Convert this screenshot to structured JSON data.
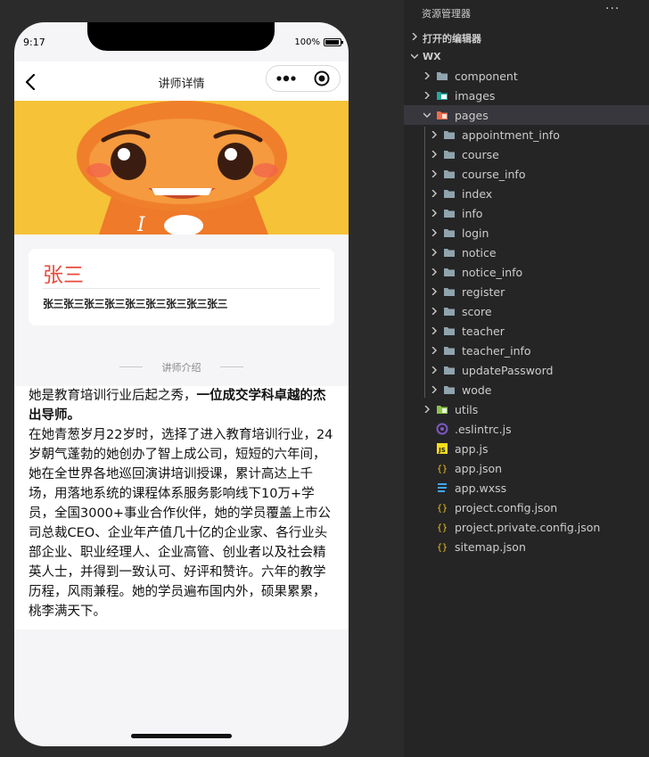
{
  "phone": {
    "status": {
      "time": "9:17",
      "battery": "100%"
    },
    "navbar": {
      "title": "讲师详情"
    },
    "teacher": {
      "name": "张三",
      "subtitle": "张三张三张三张三张三张三张三张三张三"
    },
    "section_title": "讲师介绍",
    "intro": {
      "text_before": "她是教育培训行业后起之秀，",
      "highlight": "一位成交学科卓越的杰出导师。",
      "text_after": "在她青葱岁月22岁时，选择了进入教育培训行业，24岁朝气蓬勃的她创办了智上成公司，短短的六年间，她在全世界各地巡回演讲培训授课，累计高达上千场，用落地系统的课程体系服务影响线下10万+学员，全国3000+事业合作伙伴，她的学员覆盖上市公司总裁CEO、企业年产值几十亿的企业家、各行业头部企业、职业经理人、企业高管、创业者以及社会精英人士，并得到一致认可、好评和赞许。六年的教学历程，风雨兼程。她的学员遍布国内外，硕果累累，桃李满天下。"
    }
  },
  "explorer": {
    "title": "资源管理器",
    "more": "···",
    "open_editors": "打开的编辑器",
    "root": "WX",
    "items": [
      {
        "label": "component",
        "type": "folder"
      },
      {
        "label": "images",
        "type": "folder-images"
      },
      {
        "label": "pages",
        "type": "folder-pages"
      },
      {
        "label": "appointment_info",
        "type": "folder"
      },
      {
        "label": "course",
        "type": "folder"
      },
      {
        "label": "course_info",
        "type": "folder"
      },
      {
        "label": "index",
        "type": "folder"
      },
      {
        "label": "info",
        "type": "folder"
      },
      {
        "label": "login",
        "type": "folder"
      },
      {
        "label": "notice",
        "type": "folder"
      },
      {
        "label": "notice_info",
        "type": "folder"
      },
      {
        "label": "register",
        "type": "folder"
      },
      {
        "label": "score",
        "type": "folder"
      },
      {
        "label": "teacher",
        "type": "folder"
      },
      {
        "label": "teacher_info",
        "type": "folder"
      },
      {
        "label": "updatePassword",
        "type": "folder"
      },
      {
        "label": "wode",
        "type": "folder"
      },
      {
        "label": "utils",
        "type": "folder-utils"
      },
      {
        "label": ".eslintrc.js",
        "type": "eslint-file"
      },
      {
        "label": "app.js",
        "type": "js-file"
      },
      {
        "label": "app.json",
        "type": "json-file"
      },
      {
        "label": "app.wxss",
        "type": "css-file"
      },
      {
        "label": "project.config.json",
        "type": "json-file"
      },
      {
        "label": "project.private.config.json",
        "type": "json-file"
      },
      {
        "label": "sitemap.json",
        "type": "json-file"
      }
    ],
    "colors": {
      "background": "#252526",
      "text": "#cccccc",
      "selected": "#37373d",
      "folder": "#90a4ae",
      "json": "#f5c518",
      "js": "#f5de19",
      "css": "#42a5f5"
    }
  }
}
